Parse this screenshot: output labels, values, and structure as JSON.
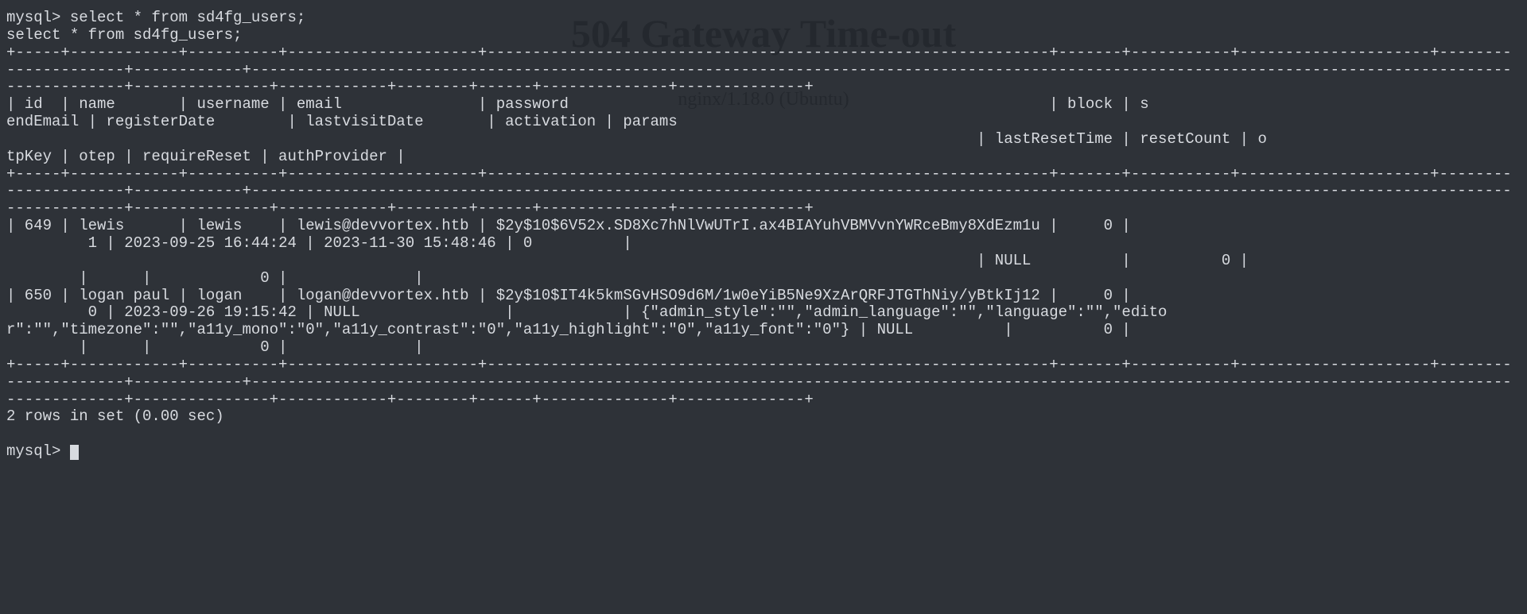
{
  "ghost": {
    "title": "504 Gateway Time-out",
    "subtitle": "nginx/1.18.0 (Ubuntu)"
  },
  "terminal": {
    "prompt": "mysql>",
    "query_echo_1": "select * from sd4fg_users;",
    "query_echo_2": "select * from sd4fg_users;",
    "border1": "+-----+------------+----------+---------------------+--------------------------------------------------------------+-------+-----------+---------------------+---------------------+------------+--------------------------------------------------------------------------------------------------------------------------------------------------------+---------------+------------+--------+------+--------------+--------------+",
    "headers_line1": "| id  | name       | username | email               | password                                                     | block | s",
    "headers_line2": "endEmail | registerDate        | lastvisitDate       | activation | params",
    "headers_line3": "                                                                                                           | lastResetTime | resetCount | o",
    "headers_line4": "tpKey | otep | requireReset | authProvider |",
    "border2": "+-----+------------+----------+---------------------+--------------------------------------------------------------+-------+-----------+---------------------+---------------------+------------+--------------------------------------------------------------------------------------------------------------------------------------------------------+---------------+------------+--------+------+--------------+--------------+",
    "row1_line1": "| 649 | lewis      | lewis    | lewis@devvortex.htb | $2y$10$6V52x.SD8Xc7hNlVwUTrI.ax4BIAYuhVBMVvnYWRceBmy8XdEzm1u |     0 |",
    "row1_line2": "         1 | 2023-09-25 16:44:24 | 2023-11-30 15:48:46 | 0          |",
    "row1_line3": "                                                                                                           | NULL          |          0 |",
    "row1_line4": "        |      |            0 |              |",
    "row2_line1": "| 650 | logan paul | logan    | logan@devvortex.htb | $2y$10$IT4k5kmSGvHSO9d6M/1w0eYiB5Ne9XzArQRFJTGThNiy/yBtkIj12 |     0 |",
    "row2_line2": "         0 | 2023-09-26 19:15:42 | NULL                |            | {\"admin_style\":\"\",\"admin_language\":\"\",\"language\":\"\",\"edito",
    "row2_line3": "r\":\"\",\"timezone\":\"\",\"a11y_mono\":\"0\",\"a11y_contrast\":\"0\",\"a11y_highlight\":\"0\",\"a11y_font\":\"0\"} | NULL          |          0 |",
    "row2_line4": "        |      |            0 |              |",
    "border3": "+-----+------------+----------+---------------------+--------------------------------------------------------------+-------+-----------+---------------------+---------------------+------------+--------------------------------------------------------------------------------------------------------------------------------------------------------+---------------+------------+--------+------+--------------+--------------+",
    "footer": "2 rows in set (0.00 sec)"
  },
  "query_result": {
    "table": "sd4fg_users",
    "columns": [
      "id",
      "name",
      "username",
      "email",
      "password",
      "block",
      "sendEmail",
      "registerDate",
      "lastvisitDate",
      "activation",
      "params",
      "lastResetTime",
      "resetCount",
      "otpKey",
      "otep",
      "requireReset",
      "authProvider"
    ],
    "rows": [
      {
        "id": 649,
        "name": "lewis",
        "username": "lewis",
        "email": "lewis@devvortex.htb",
        "password": "$2y$10$6V52x.SD8Xc7hNlVwUTrI.ax4BIAYuhVBMVvnYWRceBmy8XdEzm1u",
        "block": 0,
        "sendEmail": 1,
        "registerDate": "2023-09-25 16:44:24",
        "lastvisitDate": "2023-11-30 15:48:46",
        "activation": "0",
        "params": "",
        "lastResetTime": "NULL",
        "resetCount": 0,
        "otpKey": "",
        "otep": "",
        "requireReset": 0,
        "authProvider": ""
      },
      {
        "id": 650,
        "name": "logan paul",
        "username": "logan",
        "email": "logan@devvortex.htb",
        "password": "$2y$10$IT4k5kmSGvHSO9d6M/1w0eYiB5Ne9XzArQRFJTGThNiy/yBtkIj12",
        "block": 0,
        "sendEmail": 0,
        "registerDate": "2023-09-26 19:15:42",
        "lastvisitDate": "NULL",
        "activation": "",
        "params": "{\"admin_style\":\"\",\"admin_language\":\"\",\"language\":\"\",\"editor\":\"\",\"timezone\":\"\",\"a11y_mono\":\"0\",\"a11y_contrast\":\"0\",\"a11y_highlight\":\"0\",\"a11y_font\":\"0\"}",
        "lastResetTime": "NULL",
        "resetCount": 0,
        "otpKey": "",
        "otep": "",
        "requireReset": 0,
        "authProvider": ""
      }
    ],
    "row_count": 2,
    "elapsed": "0.00 sec"
  }
}
